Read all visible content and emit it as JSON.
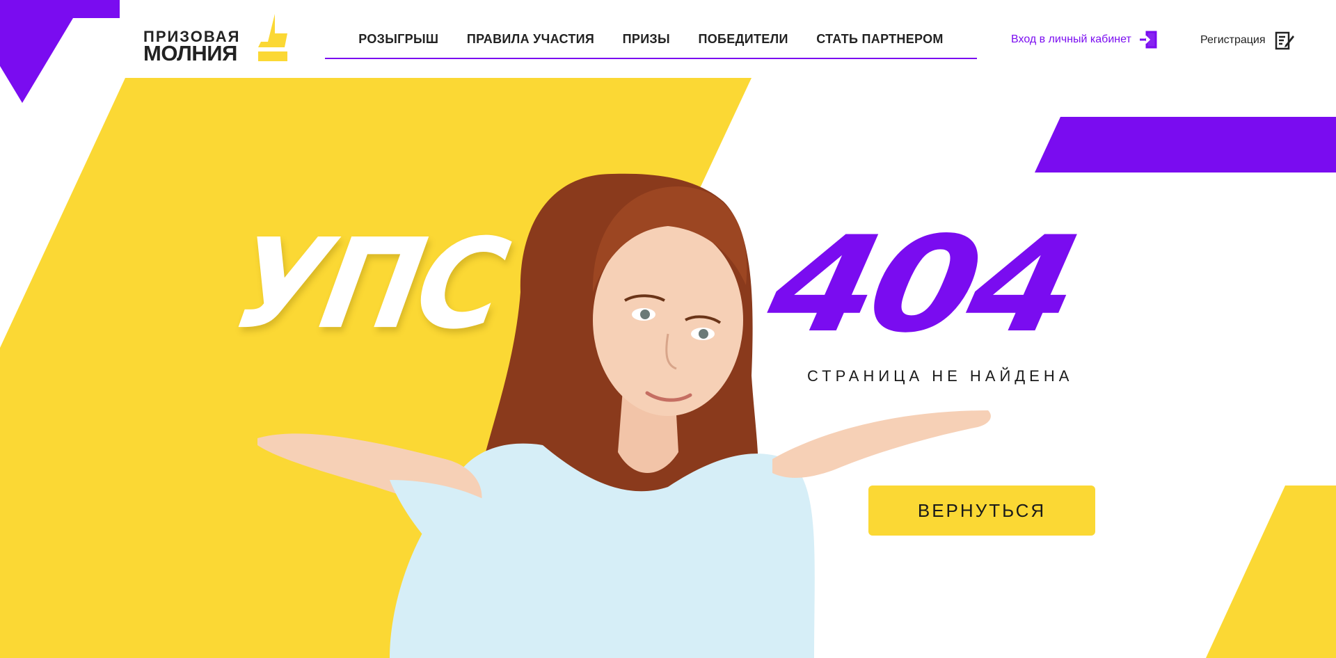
{
  "brand": {
    "logo_line1": "ПРИЗОВАЯ",
    "logo_line2": "МОЛНИЯ",
    "accent_purple": "#7a0cf0",
    "accent_yellow": "#fbd834",
    "text_dark": "#222222"
  },
  "nav": {
    "items": [
      {
        "label": "РОЗЫГРЫШ"
      },
      {
        "label": "ПРАВИЛА УЧАСТИЯ"
      },
      {
        "label": "ПРИЗЫ"
      },
      {
        "label": "ПОБЕДИТЕЛИ"
      },
      {
        "label": "СТАТЬ ПАРТНЕРОМ"
      }
    ]
  },
  "account": {
    "login_label": "Вход в личный кабинет",
    "login_icon": "login-icon",
    "register_label": "Регистрация",
    "register_icon": "register-icon"
  },
  "hero": {
    "oops": "УПС",
    "code": "404",
    "message": "СТРАНИЦА НЕ НАЙДЕНА",
    "back_label": "ВЕРНУТЬСЯ"
  }
}
